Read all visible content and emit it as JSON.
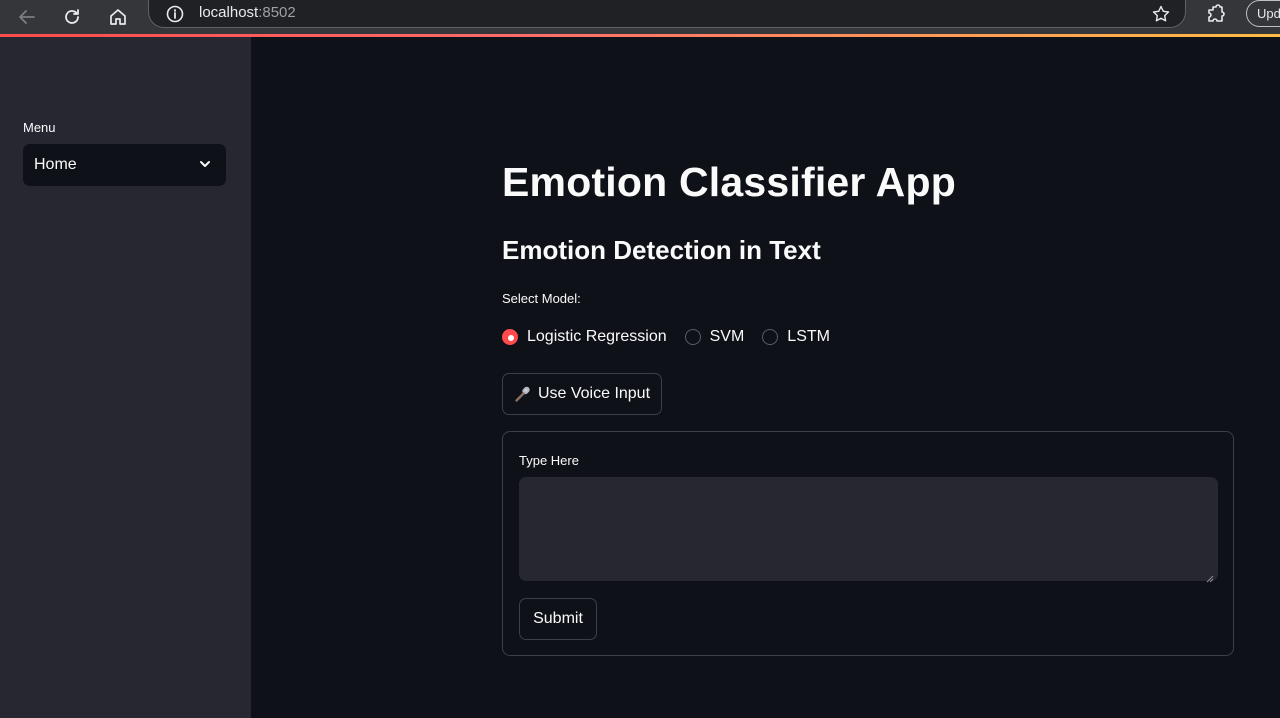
{
  "browser": {
    "url_host": "localhost",
    "url_port": ":8502",
    "update_label": "Upd"
  },
  "sidebar": {
    "menu_label": "Menu",
    "select_value": "Home"
  },
  "main": {
    "title": "Emotion Classifier App",
    "subtitle": "Emotion Detection in Text",
    "model_label": "Select Model:",
    "models": [
      {
        "label": "Logistic Regression",
        "selected": true
      },
      {
        "label": "SVM",
        "selected": false
      },
      {
        "label": "LSTM",
        "selected": false
      }
    ],
    "voice_button_label": "Use Voice Input",
    "form": {
      "input_label": "Type Here",
      "input_value": "",
      "submit_label": "Submit"
    }
  },
  "colors": {
    "accent": "#ff4b4b",
    "background": "#0e1117",
    "sidebar": "#262730"
  }
}
